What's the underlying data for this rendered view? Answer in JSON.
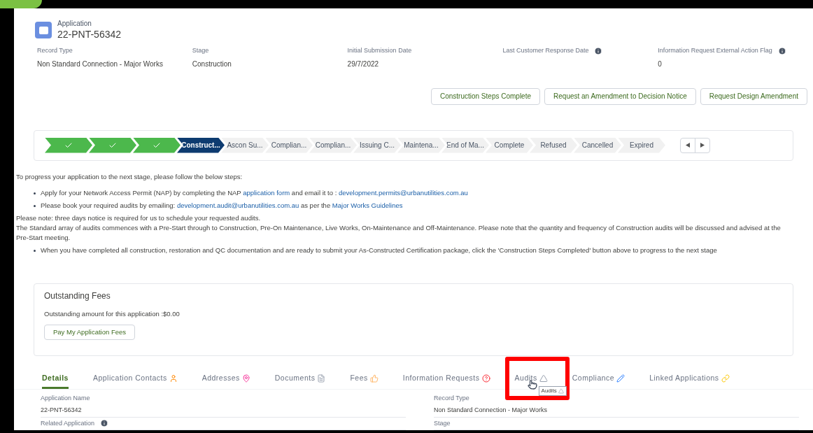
{
  "header": {
    "object_type": "Application",
    "record_number": "22-PNT-56342"
  },
  "fields": [
    {
      "label": "Record Type",
      "value": "Non Standard Connection - Major Works",
      "info": false
    },
    {
      "label": "Stage",
      "value": "Construction",
      "info": false
    },
    {
      "label": "Initial Submission Date",
      "value": "29/7/2022",
      "info": false
    },
    {
      "label": "Last Customer Response Date",
      "info": true
    },
    {
      "label": "Information Request External Action Flag",
      "value": "0",
      "info": true
    }
  ],
  "actions": [
    "Construction Steps Complete",
    "Request an Amendment to Decision Notice",
    "Request Design Amendment"
  ],
  "path": [
    {
      "completed": true,
      "selected": false
    },
    {
      "completed": true,
      "selected": false
    },
    {
      "completed": true,
      "selected": false
    },
    {
      "completed": false,
      "selected": true,
      "label": "Construct..."
    },
    {
      "completed": false,
      "selected": false,
      "label": "Ascon Su..."
    },
    {
      "completed": false,
      "selected": false,
      "label": "Complian..."
    },
    {
      "completed": false,
      "selected": false,
      "label": "Complian..."
    },
    {
      "completed": false,
      "selected": false,
      "label": "Issuing C..."
    },
    {
      "completed": false,
      "selected": false,
      "label": "Maintena..."
    },
    {
      "completed": false,
      "selected": false,
      "label": "End of Ma..."
    },
    {
      "completed": false,
      "selected": false,
      "label": "Complete"
    },
    {
      "completed": false,
      "selected": false,
      "label": "Refused"
    },
    {
      "completed": false,
      "selected": false,
      "label": "Cancelled"
    },
    {
      "completed": false,
      "selected": false,
      "label": "Expired"
    }
  ],
  "instructions": {
    "intro": "To progress your application to the next stage, please follow the below steps:",
    "lines": [
      {
        "kind": "bullet",
        "segments": [
          {
            "text": "Apply for your Network Access Permit (NAP) by completing the NAP ",
            "link": false
          },
          {
            "text": "application form",
            "link": true
          },
          {
            "text": " and email it to : ",
            "link": false
          },
          {
            "text": "development.permits@urbanutilities.com.au",
            "link": true
          }
        ]
      },
      {
        "kind": "bullet",
        "segments": [
          {
            "text": "Please book your required audits by emailing: ",
            "link": false
          },
          {
            "text": "development.audit@urbanutilities.com.au",
            "link": true
          },
          {
            "text": " as per the ",
            "link": false
          },
          {
            "text": "Major Works Guidelines",
            "link": true
          }
        ]
      },
      {
        "kind": "plain",
        "segments": [
          {
            "text": "Please note: three days notice is required for us to schedule your requested audits.",
            "link": false
          }
        ]
      },
      {
        "kind": "plain",
        "segments": [
          {
            "text": "The Standard array of audits commences with a Pre-Start through to Construction, Pre-On Maintenance, Live Works, On-Maintenance and Off-Maintenance. Please note that the quantity and frequency of Construction audits will be discussed and advised at the Pre-Start meeting.",
            "link": false
          }
        ]
      },
      {
        "kind": "bullet",
        "segments": [
          {
            "text": "When you have completed all construction, restoration and QC documentation and are ready to submit your As-Constructed Certification package, click the 'Construction Steps Completed' button above to progress to the next stage",
            "link": false
          }
        ]
      }
    ]
  },
  "fees": {
    "title": "Outstanding Fees",
    "amount_text": "Outstanding amount for this application :$0.00",
    "button": "Pay My Application Fees"
  },
  "tabs": [
    {
      "label": "Details",
      "selected": true,
      "highlighted": false
    },
    {
      "label": "Application Contacts",
      "selected": false,
      "highlighted": false
    },
    {
      "label": "Addresses",
      "selected": false,
      "highlighted": false
    },
    {
      "label": "Documents",
      "selected": false,
      "highlighted": false
    },
    {
      "label": "Fees",
      "selected": false,
      "highlighted": false
    },
    {
      "label": "Information Requests",
      "selected": false,
      "highlighted": false
    },
    {
      "label": "Audits",
      "selected": false,
      "highlighted": true,
      "tooltip": "Audits"
    },
    {
      "label": "Compliance",
      "selected": false,
      "highlighted": false
    },
    {
      "label": "Linked Applications",
      "selected": false,
      "highlighted": false
    }
  ],
  "details": {
    "left": [
      {
        "label": "Application Name",
        "value": "22-PNT-56342",
        "info": false
      },
      {
        "label": "Related Application",
        "info": true
      }
    ],
    "right": [
      {
        "label": "Record Type",
        "value": "Non Standard Connection - Major Works",
        "info": false
      },
      {
        "label": "Stage",
        "info": false
      }
    ]
  }
}
